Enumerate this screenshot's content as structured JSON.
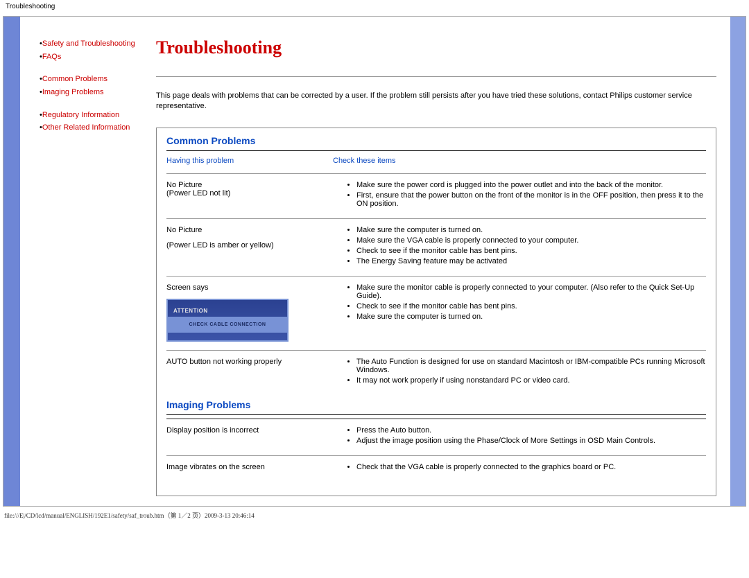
{
  "header": {
    "title": "Troubleshooting"
  },
  "sidebar": {
    "group1": [
      {
        "label": "Safety and Troubleshooting"
      },
      {
        "label": "FAQs"
      }
    ],
    "group2": [
      {
        "label": "Common Problems"
      },
      {
        "label": "Imaging Problems"
      }
    ],
    "group3": [
      {
        "label": "Regulatory Information"
      },
      {
        "label": "Other Related Information"
      }
    ]
  },
  "main": {
    "title": "Troubleshooting",
    "intro": "This page deals with problems that can be corrected by a user. If the problem still persists after you have tried these solutions, contact Philips customer service representative.",
    "common": {
      "heading": "Common Problems",
      "col_a": "Having this problem",
      "col_b": "Check these items",
      "rows": [
        {
          "problem_lines": [
            "No Picture",
            "(Power LED not lit)"
          ],
          "checks": [
            "Make sure the power cord is plugged into the power outlet and into the back of the monitor.",
            "First, ensure that the power button on the front of the monitor is in the OFF position, then press it to the ON position."
          ]
        },
        {
          "problem_lines": [
            "No Picture",
            "",
            "(Power LED is amber or yellow)"
          ],
          "checks": [
            "Make sure the computer is turned on.",
            "Make sure the VGA cable is properly connected to your computer.",
            "Check to see if the monitor cable has bent pins.",
            "The Energy Saving feature may be activated"
          ]
        },
        {
          "problem_lines": [
            "Screen says"
          ],
          "attention": {
            "top": "ATTENTION",
            "bot": "CHECK CABLE CONNECTION"
          },
          "checks": [
            "Make sure the monitor cable is properly connected to your computer. (Also refer to the Quick Set-Up Guide).",
            "Check to see if the monitor cable has bent pins.",
            "Make sure the computer is turned on."
          ]
        },
        {
          "problem_lines": [
            "AUTO button not working properly"
          ],
          "checks": [
            "The Auto Function is designed for use on standard Macintosh or IBM-compatible PCs running Microsoft Windows.",
            "It may not work properly if using nonstandard PC or video card."
          ]
        }
      ]
    },
    "imaging": {
      "heading": "Imaging Problems",
      "rows": [
        {
          "problem_lines": [
            "Display position is incorrect"
          ],
          "checks": [
            "Press the Auto button.",
            "Adjust the image position using the Phase/Clock of More Settings in OSD Main Controls."
          ]
        },
        {
          "problem_lines": [
            "Image vibrates on the screen"
          ],
          "checks": [
            "Check that the VGA cable is properly connected to the graphics board or PC."
          ]
        }
      ]
    }
  },
  "footer": {
    "path": "file:///E|/CD/lcd/manual/ENGLISH/192E1/safety/saf_troub.htm（第 1／2 页）2009-3-13 20:46:14"
  }
}
